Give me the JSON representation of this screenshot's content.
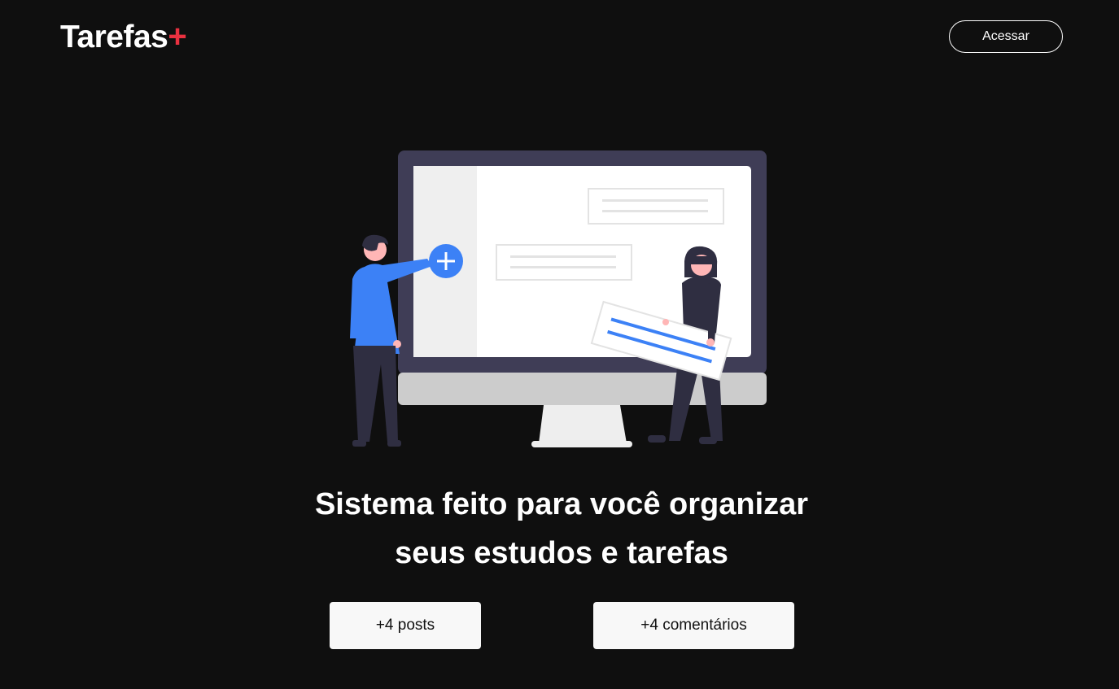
{
  "header": {
    "logo_text": "Tarefas",
    "logo_plus": "+",
    "login_label": "Acessar"
  },
  "hero": {
    "illustration_icon": "people-organizing-tasks-on-monitor-illustration",
    "headline_line1": "Sistema feito para você organizar",
    "headline_line2": "seus estudos e tarefas"
  },
  "stats": {
    "posts_label": "+4 posts",
    "comments_label": "+4 comentários"
  },
  "colors": {
    "background": "#0f0f0f",
    "accent": "#ea3140",
    "primary_blue": "#3c81f6",
    "stat_box_bg": "#f8f8f8"
  }
}
